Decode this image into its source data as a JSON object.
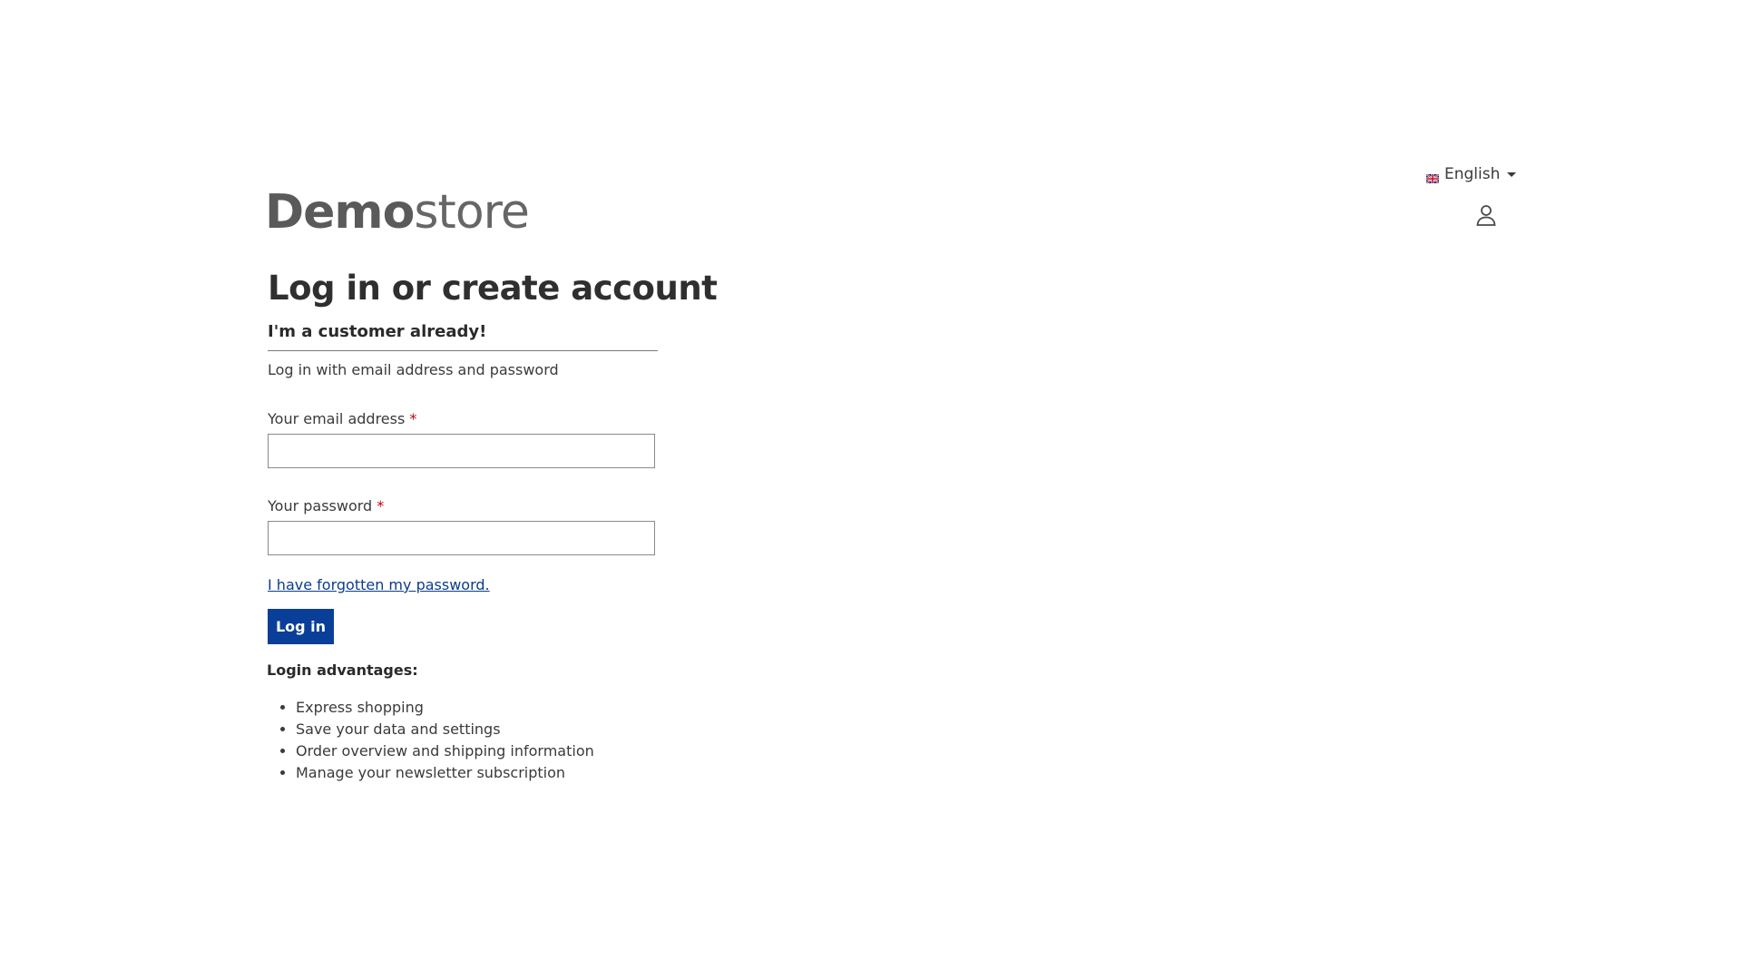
{
  "header": {
    "language": {
      "label": "English",
      "flag": "uk-flag-icon"
    },
    "logo": {
      "bold": "Demo",
      "light": "store"
    },
    "account_icon": "user-icon"
  },
  "login": {
    "title": "Log in or create account",
    "subtitle": "I'm a customer already!",
    "intro": "Log in with email address and password",
    "email_label": "Your email address",
    "email_value": "",
    "password_label": "Your password",
    "password_value": "",
    "required_marker": "*",
    "forgot_link": "I have forgotten my password.",
    "submit_label": "Log in"
  },
  "advantages": {
    "title": "Login advantages:",
    "items": [
      "Express shopping",
      "Save your data and settings",
      "Order overview and shipping information",
      "Manage your newsletter subscription"
    ]
  },
  "colors": {
    "primary": "#0a3f99",
    "link": "#0b3c8c",
    "required": "#c2000c"
  }
}
